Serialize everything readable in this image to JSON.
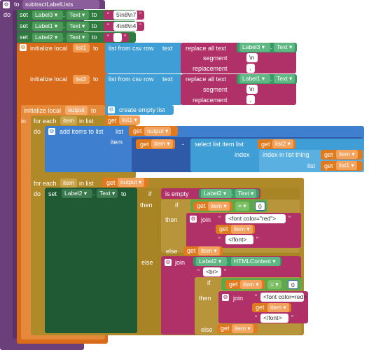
{
  "procedure": {
    "to": "to",
    "name": "subtractLabelLists",
    "do": "do"
  },
  "set_blocks": [
    {
      "set": "set",
      "component": "Label3",
      "prop": "Text",
      "to": "to",
      "value": "5\\n8\\n7"
    },
    {
      "set": "set",
      "component": "Label1",
      "prop": "Text",
      "to": "to",
      "value": "4\\n8\\n4"
    },
    {
      "set": "set",
      "component": "Label2",
      "prop": "Text",
      "to": "to",
      "value": ""
    }
  ],
  "init_list1": {
    "initialize": "initialize local",
    "name": "list1",
    "to": "to",
    "fn": "list from csv row",
    "text": "text",
    "replace": "replace all text",
    "comp": "Label3",
    "prop": "Text",
    "segment": "segment",
    "seg_value": "\\n",
    "replacement": "replacement",
    "rep_value": ","
  },
  "init_list2": {
    "initialize": "initialize local",
    "name": "list2",
    "to": "to",
    "fn": "list from csv row",
    "text": "text",
    "replace": "replace all text",
    "comp": "Label1",
    "prop": "Text",
    "segment": "segment",
    "seg_value": "\\n",
    "replacement": "replacement",
    "rep_value": ","
  },
  "init_output": {
    "initialize": "initialize local",
    "name": "output",
    "to": "to",
    "fn": "create empty list",
    "in": "in"
  },
  "for1": {
    "for_each": "for each",
    "item": "item",
    "in_list": "in list",
    "get": "get",
    "list": "list1",
    "do": "do",
    "add": "add items to list",
    "list_label": "list",
    "get_output": "output",
    "item_label": "item",
    "get_item": "item",
    "minus": "-",
    "select": "select list item  list",
    "list2": "list2",
    "index": "index",
    "index_in_list": "index in list  thing",
    "thing_item": "item",
    "list_label2": "list",
    "list1": "list1"
  },
  "for2": {
    "for_each": "for each",
    "item": "item",
    "in_list": "in list",
    "get": "get",
    "list": "output",
    "do": "do",
    "set": "set",
    "comp": "Label2",
    "prop": "Text",
    "to": "to",
    "if": "if",
    "is_empty": "is empty",
    "ie_comp": "Label2",
    "ie_prop": "Text",
    "then": "then",
    "if2": "if",
    "get_item": "item",
    "eq": "=",
    "zero": "0",
    "then2": "then",
    "join": "join",
    "red_open": "<font color=\"red\">",
    "font_close": "</font>",
    "else": "else",
    "else_item": "item",
    "else2": "else",
    "join2": "join",
    "html_comp": "Label2",
    "html_prop": "HTMLContent",
    "br": "<br>",
    "if3": "if",
    "eq2": "=",
    "zero2": "0",
    "then3": "then",
    "join3": "join",
    "red_open2": "<font color=red>",
    "font_close2": "</font>",
    "else3": "else",
    "else3_item": "item"
  }
}
